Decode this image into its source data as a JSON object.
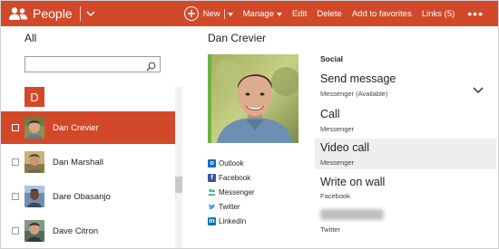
{
  "app": {
    "title": "People"
  },
  "toolbar": {
    "new_label": "New",
    "manage_label": "Manage",
    "edit_label": "Edit",
    "delete_label": "Delete",
    "add_favorites_label": "Add to favorites",
    "links_label": "Links (5)",
    "more_label": "•••"
  },
  "list": {
    "title": "All",
    "search_placeholder": "",
    "group_letter": "D",
    "contacts": [
      {
        "name": "Dan Crevier",
        "selected": true
      },
      {
        "name": "Dan Marshall",
        "selected": false
      },
      {
        "name": "Dare Obasanjo",
        "selected": false
      },
      {
        "name": "Dave Citron",
        "selected": false
      }
    ]
  },
  "profile": {
    "name": "Dan Crevier",
    "sources": [
      {
        "label": "Outlook",
        "icon": "outlook-icon",
        "color": "#0f6fc6"
      },
      {
        "label": "Facebook",
        "icon": "facebook-icon",
        "color": "#3b5998"
      },
      {
        "label": "Messenger",
        "icon": "messenger-icon",
        "color": "#3cae4a"
      },
      {
        "label": "Twitter",
        "icon": "twitter-icon",
        "color": "#2aa9e0"
      },
      {
        "label": "LinkedIn",
        "icon": "linkedin-icon",
        "color": "#0e76a8"
      }
    ]
  },
  "social": {
    "heading": "Social",
    "actions": [
      {
        "title": "Send message",
        "subtitle": "Messenger (Available)"
      },
      {
        "title": "Call",
        "subtitle": "Messenger"
      },
      {
        "title": "Video call",
        "subtitle": "Messenger"
      },
      {
        "title": "Write on wall",
        "subtitle": "Facebook"
      },
      {
        "title": "",
        "subtitle": "Twitter"
      }
    ]
  },
  "colors": {
    "accent": "#d2492a",
    "photo_accent": "#6cb33e",
    "highlight": "#eeeeee"
  }
}
